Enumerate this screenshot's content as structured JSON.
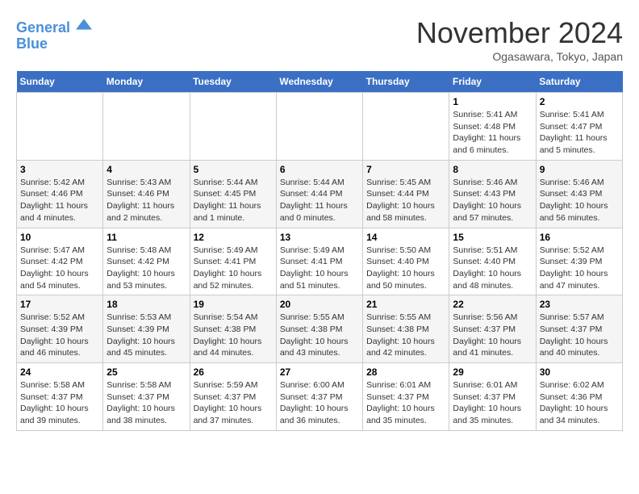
{
  "header": {
    "logo_line1": "General",
    "logo_line2": "Blue",
    "month_title": "November 2024",
    "location": "Ogasawara, Tokyo, Japan"
  },
  "weekdays": [
    "Sunday",
    "Monday",
    "Tuesday",
    "Wednesday",
    "Thursday",
    "Friday",
    "Saturday"
  ],
  "weeks": [
    [
      {
        "day": "",
        "info": ""
      },
      {
        "day": "",
        "info": ""
      },
      {
        "day": "",
        "info": ""
      },
      {
        "day": "",
        "info": ""
      },
      {
        "day": "",
        "info": ""
      },
      {
        "day": "1",
        "info": "Sunrise: 5:41 AM\nSunset: 4:48 PM\nDaylight: 11 hours\nand 6 minutes."
      },
      {
        "day": "2",
        "info": "Sunrise: 5:41 AM\nSunset: 4:47 PM\nDaylight: 11 hours\nand 5 minutes."
      }
    ],
    [
      {
        "day": "3",
        "info": "Sunrise: 5:42 AM\nSunset: 4:46 PM\nDaylight: 11 hours\nand 4 minutes."
      },
      {
        "day": "4",
        "info": "Sunrise: 5:43 AM\nSunset: 4:46 PM\nDaylight: 11 hours\nand 2 minutes."
      },
      {
        "day": "5",
        "info": "Sunrise: 5:44 AM\nSunset: 4:45 PM\nDaylight: 11 hours\nand 1 minute."
      },
      {
        "day": "6",
        "info": "Sunrise: 5:44 AM\nSunset: 4:44 PM\nDaylight: 11 hours\nand 0 minutes."
      },
      {
        "day": "7",
        "info": "Sunrise: 5:45 AM\nSunset: 4:44 PM\nDaylight: 10 hours\nand 58 minutes."
      },
      {
        "day": "8",
        "info": "Sunrise: 5:46 AM\nSunset: 4:43 PM\nDaylight: 10 hours\nand 57 minutes."
      },
      {
        "day": "9",
        "info": "Sunrise: 5:46 AM\nSunset: 4:43 PM\nDaylight: 10 hours\nand 56 minutes."
      }
    ],
    [
      {
        "day": "10",
        "info": "Sunrise: 5:47 AM\nSunset: 4:42 PM\nDaylight: 10 hours\nand 54 minutes."
      },
      {
        "day": "11",
        "info": "Sunrise: 5:48 AM\nSunset: 4:42 PM\nDaylight: 10 hours\nand 53 minutes."
      },
      {
        "day": "12",
        "info": "Sunrise: 5:49 AM\nSunset: 4:41 PM\nDaylight: 10 hours\nand 52 minutes."
      },
      {
        "day": "13",
        "info": "Sunrise: 5:49 AM\nSunset: 4:41 PM\nDaylight: 10 hours\nand 51 minutes."
      },
      {
        "day": "14",
        "info": "Sunrise: 5:50 AM\nSunset: 4:40 PM\nDaylight: 10 hours\nand 50 minutes."
      },
      {
        "day": "15",
        "info": "Sunrise: 5:51 AM\nSunset: 4:40 PM\nDaylight: 10 hours\nand 48 minutes."
      },
      {
        "day": "16",
        "info": "Sunrise: 5:52 AM\nSunset: 4:39 PM\nDaylight: 10 hours\nand 47 minutes."
      }
    ],
    [
      {
        "day": "17",
        "info": "Sunrise: 5:52 AM\nSunset: 4:39 PM\nDaylight: 10 hours\nand 46 minutes."
      },
      {
        "day": "18",
        "info": "Sunrise: 5:53 AM\nSunset: 4:39 PM\nDaylight: 10 hours\nand 45 minutes."
      },
      {
        "day": "19",
        "info": "Sunrise: 5:54 AM\nSunset: 4:38 PM\nDaylight: 10 hours\nand 44 minutes."
      },
      {
        "day": "20",
        "info": "Sunrise: 5:55 AM\nSunset: 4:38 PM\nDaylight: 10 hours\nand 43 minutes."
      },
      {
        "day": "21",
        "info": "Sunrise: 5:55 AM\nSunset: 4:38 PM\nDaylight: 10 hours\nand 42 minutes."
      },
      {
        "day": "22",
        "info": "Sunrise: 5:56 AM\nSunset: 4:37 PM\nDaylight: 10 hours\nand 41 minutes."
      },
      {
        "day": "23",
        "info": "Sunrise: 5:57 AM\nSunset: 4:37 PM\nDaylight: 10 hours\nand 40 minutes."
      }
    ],
    [
      {
        "day": "24",
        "info": "Sunrise: 5:58 AM\nSunset: 4:37 PM\nDaylight: 10 hours\nand 39 minutes."
      },
      {
        "day": "25",
        "info": "Sunrise: 5:58 AM\nSunset: 4:37 PM\nDaylight: 10 hours\nand 38 minutes."
      },
      {
        "day": "26",
        "info": "Sunrise: 5:59 AM\nSunset: 4:37 PM\nDaylight: 10 hours\nand 37 minutes."
      },
      {
        "day": "27",
        "info": "Sunrise: 6:00 AM\nSunset: 4:37 PM\nDaylight: 10 hours\nand 36 minutes."
      },
      {
        "day": "28",
        "info": "Sunrise: 6:01 AM\nSunset: 4:37 PM\nDaylight: 10 hours\nand 35 minutes."
      },
      {
        "day": "29",
        "info": "Sunrise: 6:01 AM\nSunset: 4:37 PM\nDaylight: 10 hours\nand 35 minutes."
      },
      {
        "day": "30",
        "info": "Sunrise: 6:02 AM\nSunset: 4:36 PM\nDaylight: 10 hours\nand 34 minutes."
      }
    ]
  ]
}
